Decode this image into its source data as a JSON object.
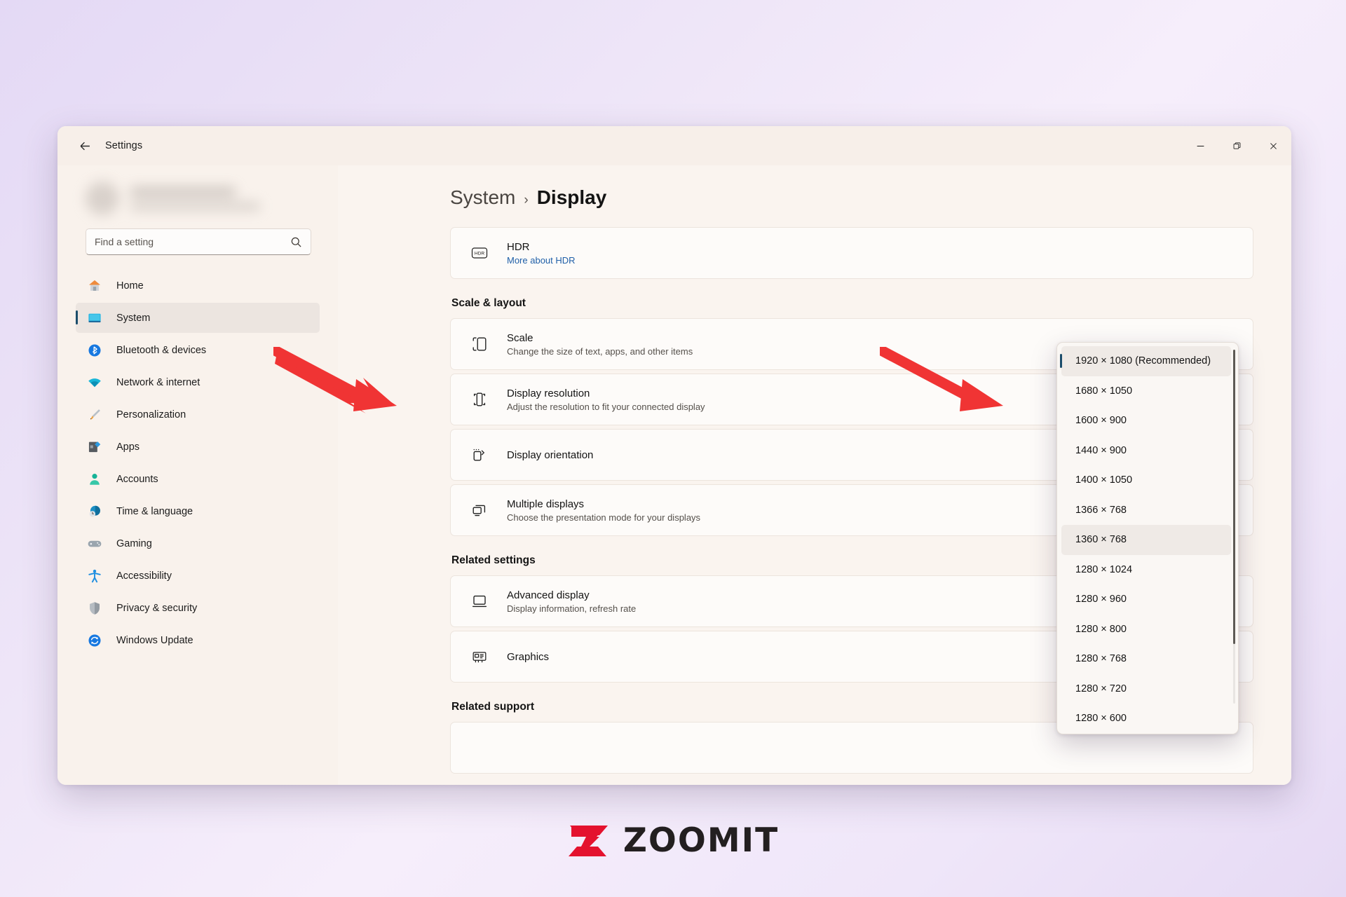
{
  "window": {
    "title": "Settings",
    "back_label": "back-arrow",
    "controls": {
      "minimize": "–",
      "maximize": "❐",
      "close": "✕"
    }
  },
  "sidebar": {
    "search": {
      "placeholder": "Find a setting",
      "value": ""
    },
    "items": [
      {
        "label": "Home",
        "icon": "home-icon",
        "active": false
      },
      {
        "label": "System",
        "icon": "system-icon",
        "active": true
      },
      {
        "label": "Bluetooth & devices",
        "icon": "bluetooth-icon",
        "active": false
      },
      {
        "label": "Network & internet",
        "icon": "wifi-icon",
        "active": false
      },
      {
        "label": "Personalization",
        "icon": "brush-icon",
        "active": false
      },
      {
        "label": "Apps",
        "icon": "apps-icon",
        "active": false
      },
      {
        "label": "Accounts",
        "icon": "account-icon",
        "active": false
      },
      {
        "label": "Time & language",
        "icon": "clock-icon",
        "active": false
      },
      {
        "label": "Gaming",
        "icon": "gamepad-icon",
        "active": false
      },
      {
        "label": "Accessibility",
        "icon": "accessibility-icon",
        "active": false
      },
      {
        "label": "Privacy & security",
        "icon": "shield-icon",
        "active": false
      },
      {
        "label": "Windows Update",
        "icon": "update-icon",
        "active": false
      }
    ]
  },
  "breadcrumb": {
    "parent": "System",
    "separator": "›",
    "current": "Display"
  },
  "main": {
    "hdr_card": {
      "title": "HDR",
      "link": "More about HDR",
      "icon": "hdr-icon"
    },
    "scale_layout_heading": "Scale & layout",
    "scale_layout_cards": [
      {
        "title": "Scale",
        "sub": "Change the size of text, apps, and other items",
        "icon": "scale-icon"
      },
      {
        "title": "Display resolution",
        "sub": "Adjust the resolution to fit your connected display",
        "icon": "resolution-icon"
      },
      {
        "title": "Display orientation",
        "sub": "",
        "icon": "orientation-icon"
      },
      {
        "title": "Multiple displays",
        "sub": "Choose the presentation mode for your displays",
        "icon": "multidisplay-icon"
      }
    ],
    "related_settings_heading": "Related settings",
    "related_settings_cards": [
      {
        "title": "Advanced display",
        "sub": "Display information, refresh rate",
        "icon": "monitor-icon",
        "chevron": "›"
      },
      {
        "title": "Graphics",
        "sub": "",
        "icon": "graphics-icon",
        "chevron": "›"
      }
    ],
    "related_support_heading": "Related support"
  },
  "resolution_dropdown": {
    "options": [
      "1920 × 1080 (Recommended)",
      "1680 × 1050",
      "1600 × 900",
      "1440 × 900",
      "1400 × 1050",
      "1366 × 768",
      "1360 × 768",
      "1280 × 1024",
      "1280 × 960",
      "1280 × 800",
      "1280 × 768",
      "1280 × 720",
      "1280 × 600"
    ],
    "selected_index": 0,
    "hovered_index": 6
  },
  "annotations": {
    "arrow_color": "#f03434",
    "arrow_left_target": "Display resolution",
    "arrow_right_target": "1360 × 768"
  },
  "watermark": {
    "text": "ZOOMIT",
    "mark_color": "#e4122e",
    "text_color": "#231f20"
  },
  "colors": {
    "accent": "#1b4d6b",
    "window_bg": "#f9f2ec",
    "content_bg": "#faf4ef",
    "card_bg": "#fdfbf9",
    "link": "#1f5fa8"
  }
}
